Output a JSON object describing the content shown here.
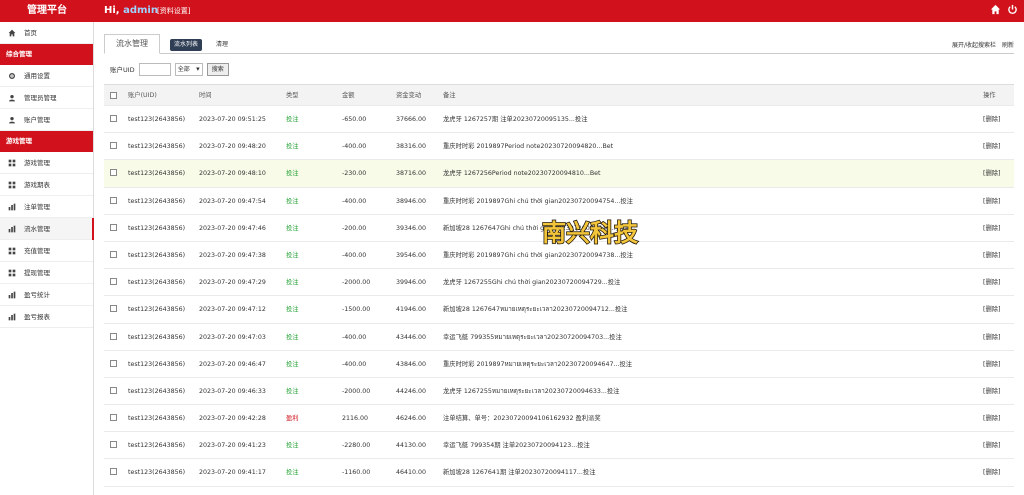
{
  "header": {
    "brand": "管理平台",
    "greeting": "Hi,",
    "username": "admin",
    "profile_link": "[资料设置]",
    "icons": [
      "home-icon",
      "power-icon"
    ]
  },
  "sidebar": {
    "top_item": {
      "label": "首页",
      "icon": "home-icon"
    },
    "sections": [
      {
        "title": "综合管理",
        "items": [
          {
            "label": "通用设置",
            "icon": "gear-icon"
          },
          {
            "label": "管理员管理",
            "icon": "user-icon"
          },
          {
            "label": "账户管理",
            "icon": "user-icon"
          }
        ]
      },
      {
        "title": "游戏管理",
        "items": [
          {
            "label": "游戏管理",
            "icon": "grid-icon"
          },
          {
            "label": "游戏期表",
            "icon": "grid-icon"
          },
          {
            "label": "注单管理",
            "icon": "bars-icon"
          },
          {
            "label": "流水管理",
            "icon": "bars-icon",
            "active": true
          },
          {
            "label": "充值管理",
            "icon": "grid-icon"
          },
          {
            "label": "提现管理",
            "icon": "grid-icon"
          },
          {
            "label": "盈亏统计",
            "icon": "bars-icon"
          },
          {
            "label": "盈亏报表",
            "icon": "bars-icon"
          }
        ]
      }
    ]
  },
  "tabs": {
    "title": "流水管理",
    "list": "流水列表",
    "clear": "清理",
    "right_links": [
      "展开/收起搜索栏",
      "刷新"
    ]
  },
  "filter": {
    "label": "账户UID",
    "input_value": "",
    "select_value": "全部",
    "search_button": "搜索"
  },
  "table": {
    "headers": {
      "account": "账户(UID)",
      "time": "时间",
      "type": "类型",
      "amount": "金额",
      "balance": "资金变动",
      "note": "备注",
      "op": "操作"
    },
    "rows": [
      {
        "account": "test123(2643856)",
        "time": "2023-07-20 09:51:25",
        "type": "投注",
        "type_color": "green",
        "amount": "-650.00",
        "balance": "37666.00",
        "note": "龙虎牙 1267257期 注单20230720095135...投注",
        "op": "[删除]"
      },
      {
        "account": "test123(2643856)",
        "time": "2023-07-20 09:48:20",
        "type": "投注",
        "type_color": "green",
        "amount": "-400.00",
        "balance": "38316.00",
        "note": "重庆时时彩 2019897Period note20230720094820...Bet",
        "op": "[删除]"
      },
      {
        "account": "test123(2643856)",
        "time": "2023-07-20 09:48:10",
        "type": "投注",
        "type_color": "green",
        "amount": "-230.00",
        "balance": "38716.00",
        "note": "龙虎牙 1267256Period note20230720094810...Bet",
        "op": "[删除]",
        "highlight": true
      },
      {
        "account": "test123(2643856)",
        "time": "2023-07-20 09:47:54",
        "type": "投注",
        "type_color": "green",
        "amount": "-400.00",
        "balance": "38946.00",
        "note": "重庆时时彩 2019897Ghi chú thời gian20230720094754...投注",
        "op": "[删除]"
      },
      {
        "account": "test123(2643856)",
        "time": "2023-07-20 09:47:46",
        "type": "投注",
        "type_color": "green",
        "amount": "-200.00",
        "balance": "39346.00",
        "note": "新加坡28 1267647Ghi chú thời gian20230720094746...投注",
        "op": "[删除]"
      },
      {
        "account": "test123(2643856)",
        "time": "2023-07-20 09:47:38",
        "type": "投注",
        "type_color": "green",
        "amount": "-400.00",
        "balance": "39546.00",
        "note": "重庆时时彩 2019897Ghi chú thời gian20230720094738...投注",
        "op": "[删除]"
      },
      {
        "account": "test123(2643856)",
        "time": "2023-07-20 09:47:29",
        "type": "投注",
        "type_color": "green",
        "amount": "-2000.00",
        "balance": "39946.00",
        "note": "龙虎牙 1267255Ghi chú thời gian20230720094729...投注",
        "op": "[删除]"
      },
      {
        "account": "test123(2643856)",
        "time": "2023-07-20 09:47:12",
        "type": "投注",
        "type_color": "green",
        "amount": "-1500.00",
        "balance": "41946.00",
        "note": "新加坡28 1267647หมายเหตุระยะเวลา20230720094712...投注",
        "op": "[删除]"
      },
      {
        "account": "test123(2643856)",
        "time": "2023-07-20 09:47:03",
        "type": "投注",
        "type_color": "green",
        "amount": "-400.00",
        "balance": "43446.00",
        "note": "幸运飞艇 799355หมายเหตุระยะเวลา20230720094703...投注",
        "op": "[删除]"
      },
      {
        "account": "test123(2643856)",
        "time": "2023-07-20 09:46:47",
        "type": "投注",
        "type_color": "green",
        "amount": "-400.00",
        "balance": "43846.00",
        "note": "重庆时时彩 2019897หมายเหตุระยะเวลา20230720094647...投注",
        "op": "[删除]"
      },
      {
        "account": "test123(2643856)",
        "time": "2023-07-20 09:46:33",
        "type": "投注",
        "type_color": "green",
        "amount": "-2000.00",
        "balance": "44246.00",
        "note": "龙虎牙 1267255หมายเหตุระยะเวลา20230720094633...投注",
        "op": "[删除]"
      },
      {
        "account": "test123(2643856)",
        "time": "2023-07-20 09:42:28",
        "type": "盈利",
        "type_color": "red",
        "amount": "2116.00",
        "balance": "46246.00",
        "note": "注单结算、单号：20230720094106162932 盈利派奖",
        "op": "[删除]"
      },
      {
        "account": "test123(2643856)",
        "time": "2023-07-20 09:41:23",
        "type": "投注",
        "type_color": "green",
        "amount": "-2280.00",
        "balance": "44130.00",
        "note": "幸运飞艇 799354期 注单20230720094123...投注",
        "op": "[删除]"
      },
      {
        "account": "test123(2643856)",
        "time": "2023-07-20 09:41:17",
        "type": "投注",
        "type_color": "green",
        "amount": "-1160.00",
        "balance": "46410.00",
        "note": "新加坡28 1267641期 注单20230720094117...投注",
        "op": "[删除]"
      }
    ]
  },
  "watermark": {
    "text": "南兴科技"
  }
}
